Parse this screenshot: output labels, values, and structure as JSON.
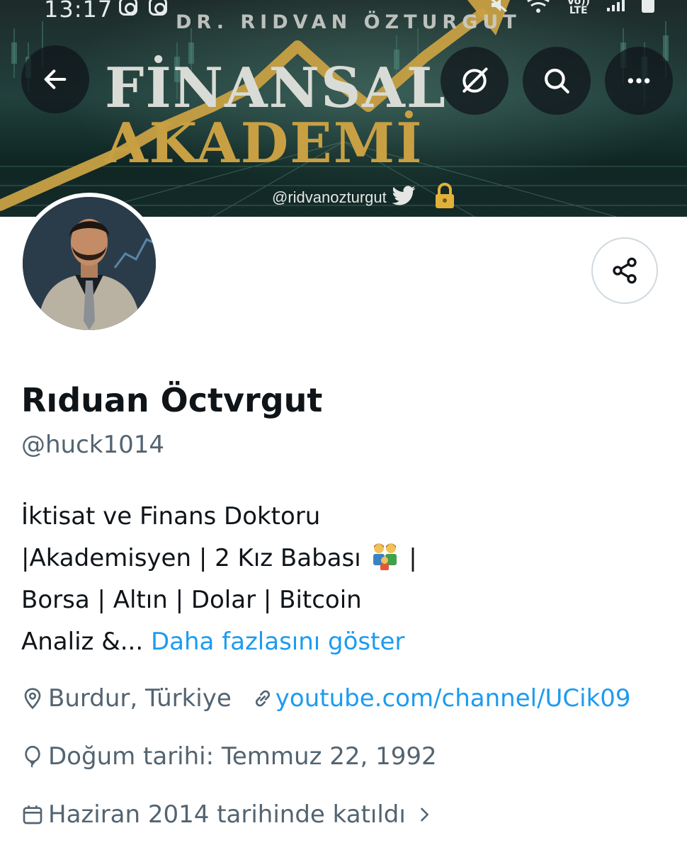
{
  "status_bar": {
    "time": "13:17",
    "network": "LTE",
    "volte": "Vo))"
  },
  "banner": {
    "brand_top": "DR. RIDVAN ÖZTURGUT",
    "brand_main_1": "FİNANSAL",
    "brand_main_2": "AKADEMİ",
    "handle": "@ridvanozturgut",
    "colors": {
      "gold": "#c8a043",
      "teal_dark": "#0f2623"
    }
  },
  "nav": {
    "back_icon": "arrow-left-icon",
    "grok_icon": "slashed-circle-icon",
    "search_icon": "search-icon",
    "more_icon": "more-horizontal-icon",
    "share_icon": "share-icon"
  },
  "profile": {
    "display_name": "Rıduan Öctvrgut",
    "handle": "@huck1014",
    "bio": {
      "line1": "İktisat ve Finans Doktoru",
      "line2_a": "|Akademisyen | 2 Kız Babası",
      "line2_emoji": "family-emoji",
      "line2_b": "|",
      "line3": "Borsa | Altın | Dolar | Bitcoin",
      "line4": "Analiz &...",
      "show_more": "Daha fazlasını göster"
    },
    "location": "Burdur, Türkiye",
    "website": "youtube.com/channel/UCik09",
    "birthday": "Doğum tarihi: Temmuz 22, 1992",
    "joined": "Haziran 2014 tarihinde katıldı",
    "colors": {
      "link": "#1d9bf0",
      "muted": "#536471",
      "text": "#0f1419"
    }
  }
}
